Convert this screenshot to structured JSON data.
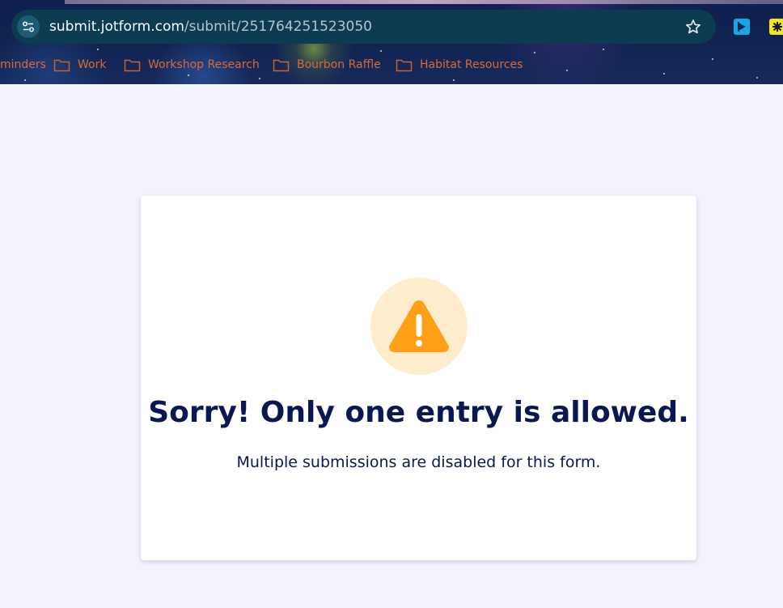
{
  "browser": {
    "url_host": "submit.jotform.com",
    "url_path": "/submit/251764251523050",
    "site_info_icon": "tune-icon",
    "bookmark_icon": "star-outline-icon",
    "extensions": [
      {
        "name": "extension-blue-icon",
        "color": "#16a6e0"
      },
      {
        "name": "extension-yellow-icon",
        "color": "#f2e623"
      }
    ]
  },
  "bookmarks": [
    {
      "label": "minders",
      "has_icon": false
    },
    {
      "label": "Work",
      "has_icon": true
    },
    {
      "label": "Workshop Research",
      "has_icon": true
    },
    {
      "label": "Bourbon Raffle",
      "has_icon": true
    },
    {
      "label": "Habitat Resources",
      "has_icon": true
    }
  ],
  "message": {
    "icon": "warning-triangle-icon",
    "title": "Sorry! Only one entry is allowed.",
    "subtitle": "Multiple submissions are disabled for this form."
  },
  "colors": {
    "page_background": "#f3f3fe",
    "title_color": "#0b1750",
    "warning_orange": "#ffa117",
    "warning_circle": "#ffeccc",
    "bookmark_text": "#d96a3a"
  }
}
